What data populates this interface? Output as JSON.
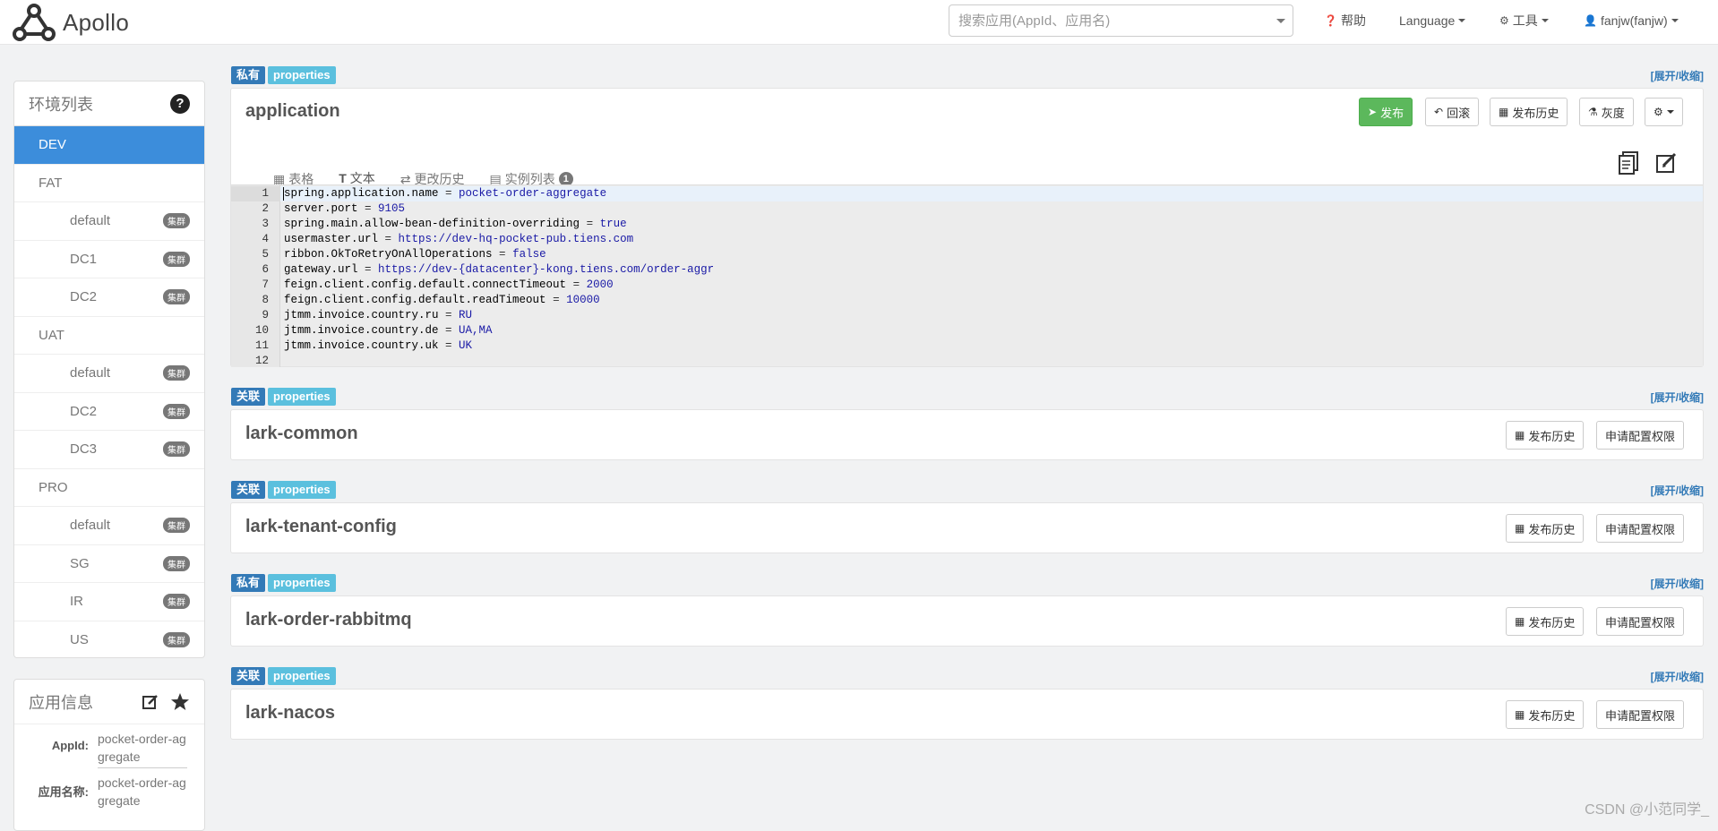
{
  "brand": {
    "name": "Apollo"
  },
  "header": {
    "search_placeholder": "搜索应用(AppId、应用名)",
    "help": "帮助",
    "language": "Language",
    "tools": "工具",
    "user": "fanjw(fanjw)"
  },
  "env_list": {
    "title": "环境列表",
    "help_symbol": "?",
    "cluster_badge": "集群",
    "items": [
      {
        "label": "DEV",
        "type": "env",
        "active": true
      },
      {
        "label": "FAT",
        "type": "env"
      },
      {
        "label": "default",
        "type": "cluster"
      },
      {
        "label": "DC1",
        "type": "cluster"
      },
      {
        "label": "DC2",
        "type": "cluster"
      },
      {
        "label": "UAT",
        "type": "env"
      },
      {
        "label": "default",
        "type": "cluster"
      },
      {
        "label": "DC2",
        "type": "cluster"
      },
      {
        "label": "DC3",
        "type": "cluster"
      },
      {
        "label": "PRO",
        "type": "env"
      },
      {
        "label": "default",
        "type": "cluster"
      },
      {
        "label": "SG",
        "type": "cluster"
      },
      {
        "label": "IR",
        "type": "cluster"
      },
      {
        "label": "US",
        "type": "cluster"
      }
    ]
  },
  "app_info": {
    "title": "应用信息",
    "appid_label": "AppId:",
    "appid_value": "pocket-order-aggregate",
    "name_label": "应用名称:",
    "name_value": "pocket-order-aggregate"
  },
  "toggle_label": "[展开/收缩]",
  "namespaces": [
    {
      "scope": "私有",
      "format": "properties",
      "name": "application",
      "buttons": {
        "publish": "发布",
        "rollback": "回滚",
        "history": "发布历史",
        "gray": "灰度"
      },
      "tabs": [
        "表格",
        "文本",
        "更改历史",
        "实例列表"
      ],
      "instance_count": "1",
      "lines": [
        {
          "n": "1",
          "key": "spring.application.name",
          "value": "pocket-order-aggregate"
        },
        {
          "n": "2",
          "key": "server.port",
          "value": "9105"
        },
        {
          "n": "3",
          "key": "spring.main.allow-bean-definition-overriding",
          "value": "true"
        },
        {
          "n": "4",
          "key": "usermaster.url",
          "value": "https://dev-hq-pocket-pub.tiens.com"
        },
        {
          "n": "5",
          "key": "ribbon.OkToRetryOnAllOperations",
          "value": "false"
        },
        {
          "n": "6",
          "key": "gateway.url",
          "value": "https://dev-{datacenter}-kong.tiens.com/order-aggr"
        },
        {
          "n": "7",
          "key": "feign.client.config.default.connectTimeout",
          "value": "2000"
        },
        {
          "n": "8",
          "key": "feign.client.config.default.readTimeout",
          "value": "10000"
        },
        {
          "n": "9",
          "key": "jtmm.invoice.country.ru",
          "value": "RU"
        },
        {
          "n": "10",
          "key": "jtmm.invoice.country.de",
          "value": "UA,MA"
        },
        {
          "n": "11",
          "key": "jtmm.invoice.country.uk",
          "value": "UK"
        },
        {
          "n": "12",
          "key": "",
          "value": ""
        }
      ]
    },
    {
      "scope": "关联",
      "format": "properties",
      "name": "lark-common",
      "history": "发布历史",
      "apply": "申请配置权限"
    },
    {
      "scope": "关联",
      "format": "properties",
      "name": "lark-tenant-config",
      "history": "发布历史",
      "apply": "申请配置权限"
    },
    {
      "scope": "私有",
      "format": "properties",
      "name": "lark-order-rabbitmq",
      "history": "发布历史",
      "apply": "申请配置权限"
    },
    {
      "scope": "关联",
      "format": "properties",
      "name": "lark-nacos",
      "history": "发布历史",
      "apply": "申请配置权限"
    }
  ],
  "watermark": "CSDN @小范同学_"
}
